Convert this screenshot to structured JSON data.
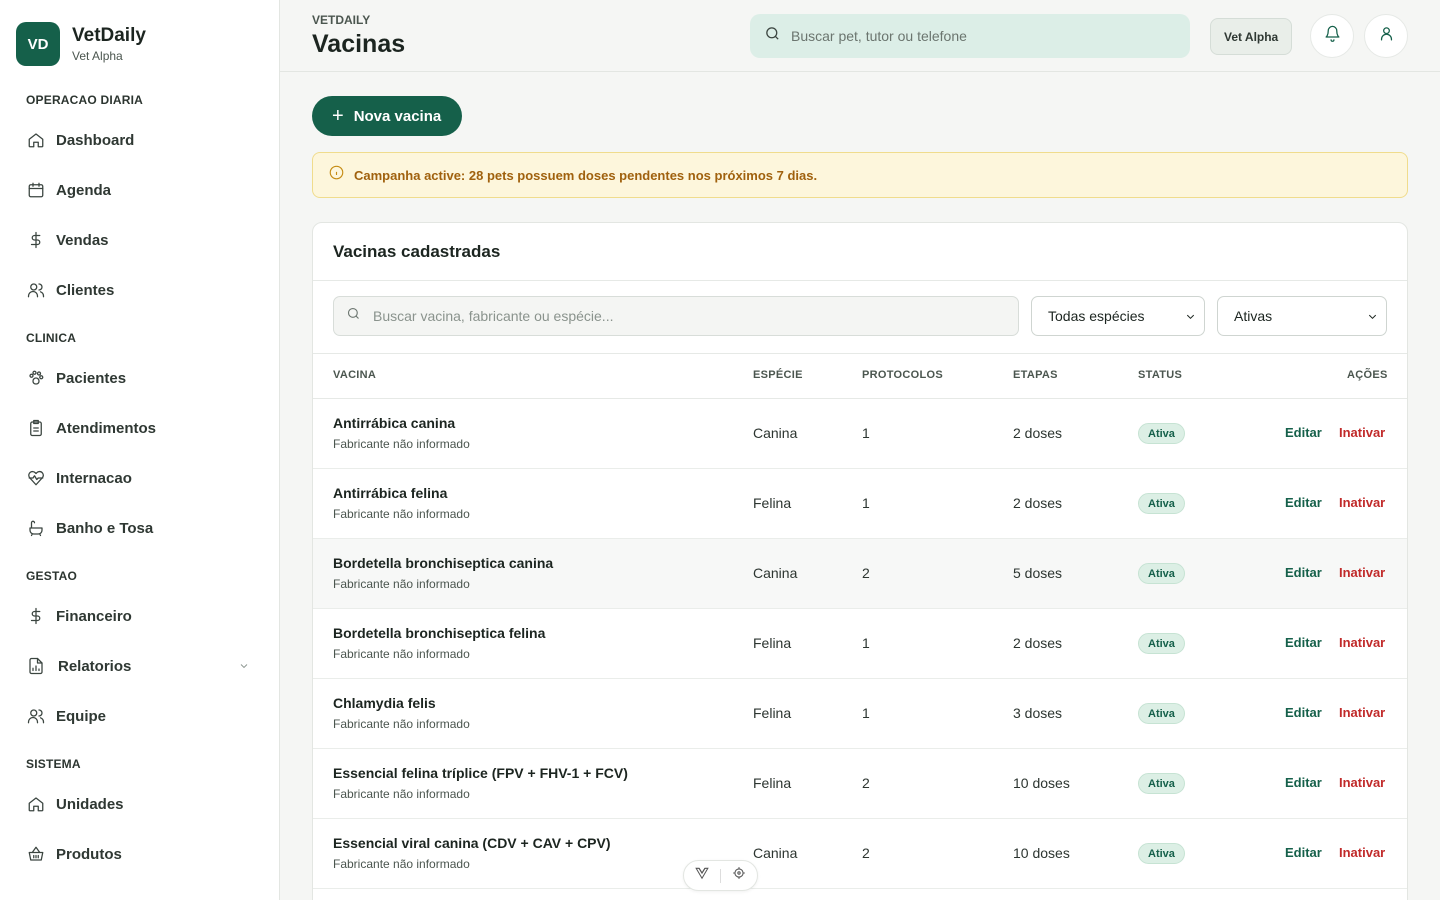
{
  "brand": {
    "initials": "VD",
    "name": "VetDaily",
    "subtitle": "Vet Alpha"
  },
  "sidebar": {
    "sections": [
      {
        "label": "OPERACAO DIARIA"
      },
      {
        "label": "CLINICA"
      },
      {
        "label": "GESTAO"
      },
      {
        "label": "SISTEMA"
      }
    ],
    "items": [
      {
        "label": "Dashboard",
        "icon": "home-icon"
      },
      {
        "label": "Agenda",
        "icon": "calendar-icon"
      },
      {
        "label": "Vendas",
        "icon": "dollar-icon"
      },
      {
        "label": "Clientes",
        "icon": "users-icon"
      },
      {
        "label": "Pacientes",
        "icon": "paw-icon"
      },
      {
        "label": "Atendimentos",
        "icon": "clipboard-icon"
      },
      {
        "label": "Internacao",
        "icon": "heart-pulse-icon"
      },
      {
        "label": "Banho e Tosa",
        "icon": "bath-icon"
      },
      {
        "label": "Financeiro",
        "icon": "dollar-icon"
      },
      {
        "label": "Relatorios",
        "icon": "report-icon"
      },
      {
        "label": "Equipe",
        "icon": "users-icon"
      },
      {
        "label": "Unidades",
        "icon": "home-icon"
      },
      {
        "label": "Produtos",
        "icon": "basket-icon"
      }
    ]
  },
  "header": {
    "breadcrumb": "VETDAILY",
    "title": "Vacinas",
    "search_placeholder": "Buscar pet, tutor ou telefone",
    "unit_button": "Vet Alpha"
  },
  "toolbar": {
    "new_button": "Nova vacina"
  },
  "alert": {
    "text": "Campanha active: 28 pets possuem doses pendentes nos próximos 7 dias."
  },
  "card": {
    "title": "Vacinas cadastradas",
    "search_placeholder": "Buscar vacina, fabricante ou espécie...",
    "species_filter": "Todas espécies",
    "status_filter": "Ativas",
    "columns": [
      "VACINA",
      "ESPÉCIE",
      "PROTOCOLOS",
      "ETAPAS",
      "STATUS",
      "AÇÕES"
    ],
    "edit_label": "Editar",
    "inactivate_label": "Inativar",
    "rows": [
      {
        "name": "Antirrábica canina",
        "maker": "Fabricante não informado",
        "species": "Canina",
        "protocols": "1",
        "steps": "2 doses",
        "status": "Ativa"
      },
      {
        "name": "Antirrábica felina",
        "maker": "Fabricante não informado",
        "species": "Felina",
        "protocols": "1",
        "steps": "2 doses",
        "status": "Ativa"
      },
      {
        "name": "Bordetella bronchiseptica canina",
        "maker": "Fabricante não informado",
        "species": "Canina",
        "protocols": "2",
        "steps": "5 doses",
        "status": "Ativa"
      },
      {
        "name": "Bordetella bronchiseptica felina",
        "maker": "Fabricante não informado",
        "species": "Felina",
        "protocols": "1",
        "steps": "2 doses",
        "status": "Ativa"
      },
      {
        "name": "Chlamydia felis",
        "maker": "Fabricante não informado",
        "species": "Felina",
        "protocols": "1",
        "steps": "3 doses",
        "status": "Ativa"
      },
      {
        "name": "Essencial felina tríplice (FPV + FHV-1 + FCV)",
        "maker": "Fabricante não informado",
        "species": "Felina",
        "protocols": "2",
        "steps": "10 doses",
        "status": "Ativa"
      },
      {
        "name": "Essencial viral canina (CDV + CAV + CPV)",
        "maker": "Fabricante não informado",
        "species": "Canina",
        "protocols": "2",
        "steps": "10 doses",
        "status": "Ativa"
      }
    ]
  },
  "colors": {
    "brand": "#15604a",
    "danger": "#c12a2a",
    "alert_bg": "#fdf6dc",
    "alert_text": "#a0610e"
  }
}
